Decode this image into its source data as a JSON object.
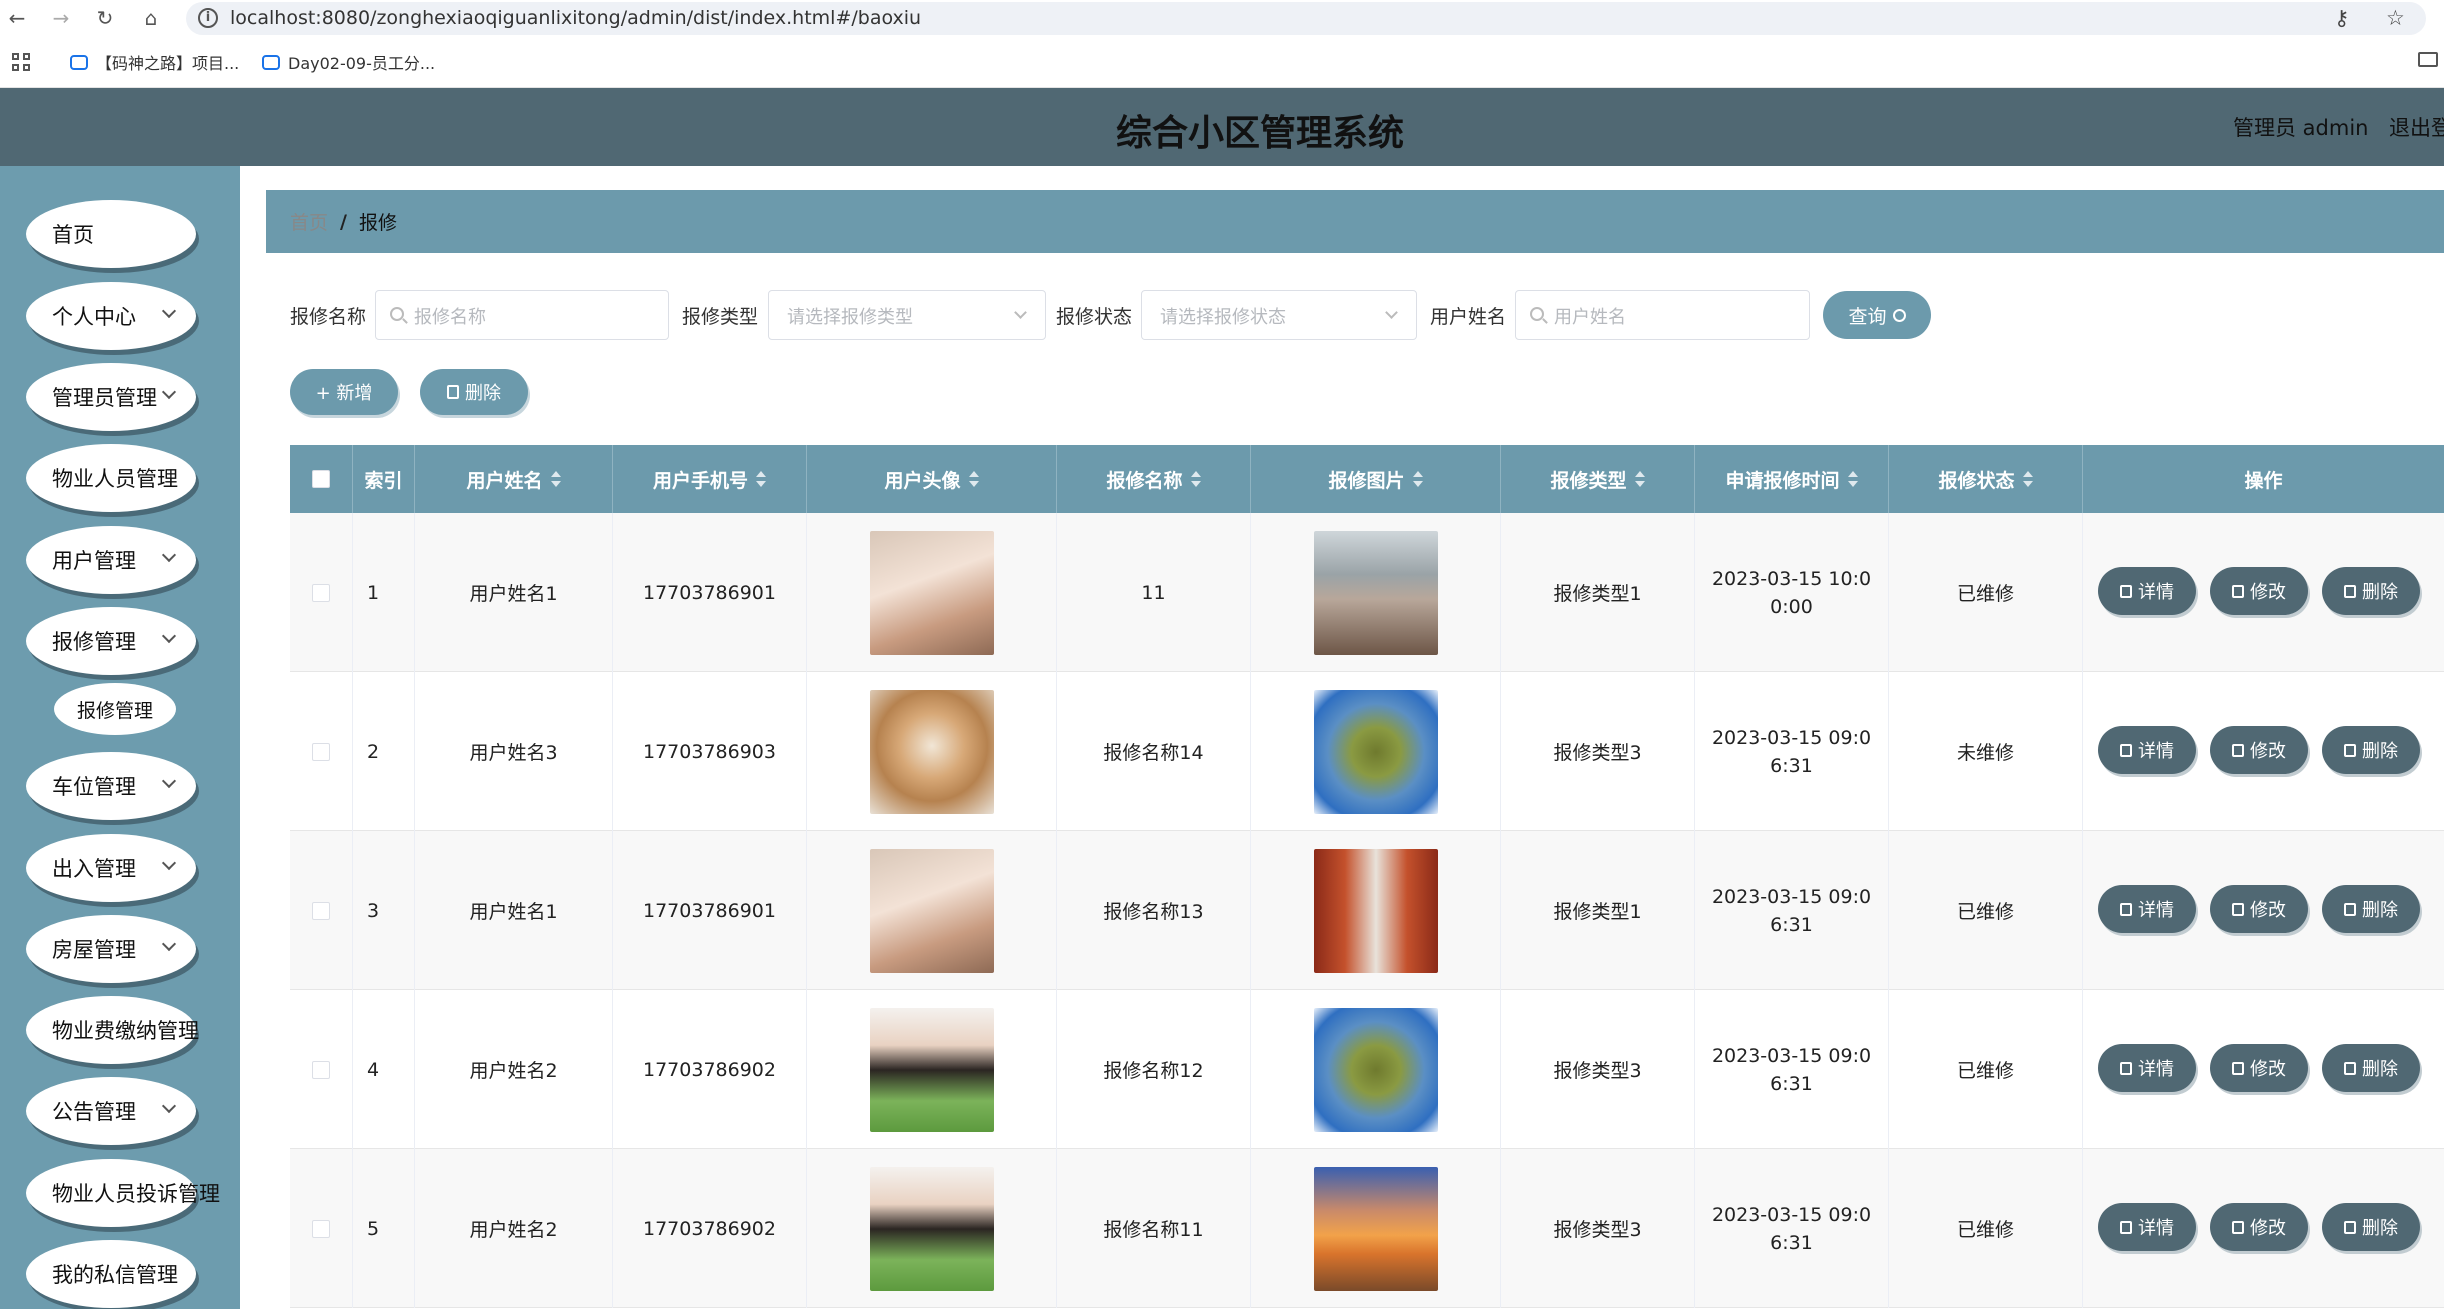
{
  "browser": {
    "url": "localhost:8080/zonghexiaoqiguanlixitong/admin/dist/index.html#/baoxiu",
    "bookmarks": [
      "【码神之路】项目...",
      "Day02-09-员工分..."
    ]
  },
  "header": {
    "title": "综合小区管理系统",
    "admin": "管理员 admin",
    "logout": "退出登"
  },
  "sidebar": {
    "items": [
      {
        "label": "首页"
      },
      {
        "label": "个人中心"
      },
      {
        "label": "管理员管理"
      },
      {
        "label": "物业人员管理"
      },
      {
        "label": "用户管理"
      },
      {
        "label": "报修管理"
      },
      {
        "label": "车位管理"
      },
      {
        "label": "出入管理"
      },
      {
        "label": "房屋管理"
      },
      {
        "label": "物业费缴纳管理"
      },
      {
        "label": "公告管理"
      },
      {
        "label": "物业人员投诉管理"
      },
      {
        "label": "我的私信管理"
      }
    ],
    "submenu": "报修管理"
  },
  "breadcrumb": {
    "home": "首页",
    "sep": "/",
    "current": "报修"
  },
  "search": {
    "name_label": "报修名称",
    "name_placeholder": "报修名称",
    "type_label": "报修类型",
    "type_placeholder": "请选择报修类型",
    "status_label": "报修状态",
    "status_placeholder": "请选择报修状态",
    "user_label": "用户姓名",
    "user_placeholder": "用户姓名",
    "query_label": "查询"
  },
  "toolbar": {
    "add_label": "+ 新增",
    "delete_label": "删除"
  },
  "table": {
    "columns": [
      "索引",
      "用户姓名",
      "用户手机号",
      "用户头像",
      "报修名称",
      "报修图片",
      "报修类型",
      "申请报修时间",
      "报修状态",
      "操作"
    ],
    "rows": [
      {
        "index": "1",
        "user": "用户姓名1",
        "phone": "17703786901",
        "name": "11",
        "type": "报修类型1",
        "time": "2023-03-15 10:00:00",
        "status": "已维修"
      },
      {
        "index": "2",
        "user": "用户姓名3",
        "phone": "17703786903",
        "name": "报修名称14",
        "type": "报修类型3",
        "time": "2023-03-15 09:06:31",
        "status": "未维修"
      },
      {
        "index": "3",
        "user": "用户姓名1",
        "phone": "17703786901",
        "name": "报修名称13",
        "type": "报修类型1",
        "time": "2023-03-15 09:06:31",
        "status": "已维修"
      },
      {
        "index": "4",
        "user": "用户姓名2",
        "phone": "17703786902",
        "name": "报修名称12",
        "type": "报修类型3",
        "time": "2023-03-15 09:06:31",
        "status": "已维修"
      },
      {
        "index": "5",
        "user": "用户姓名2",
        "phone": "17703786902",
        "name": "报修名称11",
        "type": "报修类型3",
        "time": "2023-03-15 09:06:31",
        "status": "已维修"
      }
    ],
    "actions": {
      "detail": "详情",
      "edit": "修改",
      "delete": "删除"
    }
  },
  "colors": {
    "header_bg": "#506873",
    "sidebar_bg": "#6d9cae",
    "accent": "#6c9aac",
    "action_btn": "#506873"
  }
}
